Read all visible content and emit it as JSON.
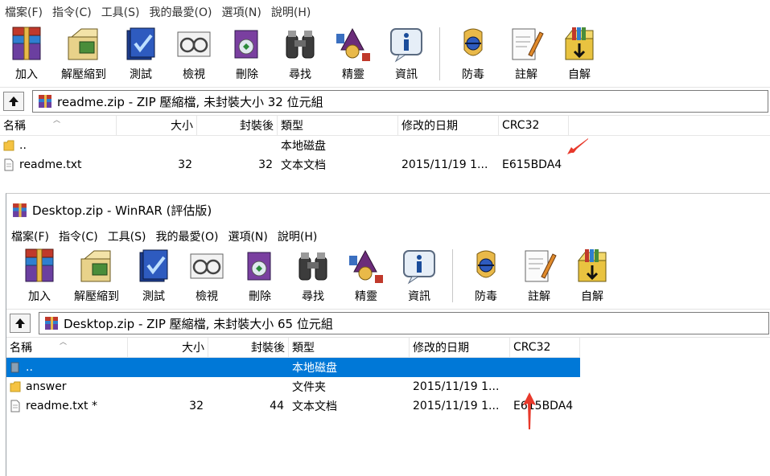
{
  "colors": {
    "selection": "#0078d7",
    "arrow": "#e8392b",
    "folder": "#f5c342"
  },
  "window1": {
    "menu": [
      "檔案(F)",
      "指令(C)",
      "工具(S)",
      "我的最愛(O)",
      "選項(N)",
      "說明(H)"
    ],
    "toolbar": [
      {
        "label": "加入",
        "icon": "add-archive-icon"
      },
      {
        "label": "解壓縮到",
        "icon": "extract-to-icon"
      },
      {
        "label": "測試",
        "icon": "test-icon"
      },
      {
        "label": "檢視",
        "icon": "view-icon"
      },
      {
        "label": "刪除",
        "icon": "delete-icon"
      },
      {
        "label": "尋找",
        "icon": "find-icon"
      },
      {
        "label": "精靈",
        "icon": "wizard-icon"
      },
      {
        "label": "資訊",
        "icon": "info-icon"
      },
      {
        "label": "防毒",
        "icon": "antivirus-icon"
      },
      {
        "label": "註解",
        "icon": "comment-icon"
      },
      {
        "label": "自解",
        "icon": "sfx-icon"
      }
    ],
    "address": "readme.zip - ZIP 壓縮檔, 未封裝大小 32 位元組",
    "columns": {
      "name": "名稱",
      "size": "大小",
      "packed": "封裝後",
      "type": "類型",
      "modified": "修改的日期",
      "crc": "CRC32"
    },
    "rows": [
      {
        "name": "..",
        "size": "",
        "packed": "",
        "type": "本地磁盘",
        "modified": "",
        "crc": "",
        "icon": "folder"
      },
      {
        "name": "readme.txt",
        "size": "32",
        "packed": "32",
        "type": "文本文档",
        "modified": "2015/11/19 1...",
        "crc": "E615BDA4",
        "icon": "file"
      }
    ]
  },
  "window2": {
    "title": "Desktop.zip - WinRAR (評估版)",
    "menu": [
      "檔案(F)",
      "指令(C)",
      "工具(S)",
      "我的最愛(O)",
      "選項(N)",
      "說明(H)"
    ],
    "toolbar": [
      {
        "label": "加入",
        "icon": "add-archive-icon"
      },
      {
        "label": "解壓縮到",
        "icon": "extract-to-icon"
      },
      {
        "label": "測試",
        "icon": "test-icon"
      },
      {
        "label": "檢視",
        "icon": "view-icon"
      },
      {
        "label": "刪除",
        "icon": "delete-icon"
      },
      {
        "label": "尋找",
        "icon": "find-icon"
      },
      {
        "label": "精靈",
        "icon": "wizard-icon"
      },
      {
        "label": "資訊",
        "icon": "info-icon"
      },
      {
        "label": "防毒",
        "icon": "antivirus-icon"
      },
      {
        "label": "註解",
        "icon": "comment-icon"
      },
      {
        "label": "自解",
        "icon": "sfx-icon"
      }
    ],
    "address": "Desktop.zip - ZIP 壓縮檔, 未封裝大小 65 位元組",
    "columns": {
      "name": "名稱",
      "size": "大小",
      "packed": "封裝後",
      "type": "類型",
      "modified": "修改的日期",
      "crc": "CRC32"
    },
    "rows": [
      {
        "name": "..",
        "size": "",
        "packed": "",
        "type": "本地磁盘",
        "modified": "",
        "crc": "",
        "icon": "drive",
        "selected": true
      },
      {
        "name": "answer",
        "size": "",
        "packed": "",
        "type": "文件夹",
        "modified": "2015/11/19 1...",
        "crc": "",
        "icon": "folder"
      },
      {
        "name": "readme.txt *",
        "size": "32",
        "packed": "44",
        "type": "文本文档",
        "modified": "2015/11/19 1...",
        "crc": "E615BDA4",
        "icon": "file"
      }
    ]
  }
}
